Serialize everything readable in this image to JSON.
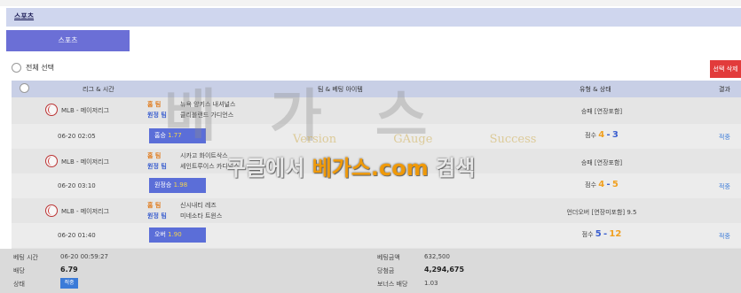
{
  "header": {
    "title": "스포츠"
  },
  "tabs": {
    "sport_tab": "스포츠"
  },
  "toolbar": {
    "select_all": "전체 선택",
    "delete_selected": "선택 삭제"
  },
  "table": {
    "headers": {
      "league_time": "리그 & 시간",
      "team_item": "팀 & 베팅 아이템",
      "type_status": "유형 & 상태",
      "result": "결과"
    }
  },
  "bets": [
    {
      "league": "MLB - 메이저리그",
      "home_tag": "홈 팀",
      "home_team": "뉴욕 양키스 내셔널스",
      "away_tag": "원정 팀",
      "away_team": "클리블랜드 가디언스",
      "bet_type": "승패 [연장포함]",
      "time": "06-20 02:05",
      "pick_label": "홈승",
      "pick_odds": "1.77",
      "score_label": "점수",
      "score_home": "4",
      "score_sep": "-",
      "score_away": "3",
      "result": "적중"
    },
    {
      "league": "MLB - 메이저리그",
      "home_tag": "홈 팀",
      "home_team": "시카고 화이트삭스",
      "away_tag": "원정 팀",
      "away_team": "세인트루이스 카디널스",
      "bet_type": "승패 [연장포함]",
      "time": "06-20 03:10",
      "pick_label": "원정승",
      "pick_odds": "1.98",
      "score_label": "점수",
      "score_home": "4",
      "score_sep": "-",
      "score_away": "5",
      "result": "적중"
    },
    {
      "league": "MLB - 메이저리그",
      "home_tag": "홈 팀",
      "home_team": "신시내티 레즈",
      "away_tag": "원정 팀",
      "away_team": "미네소타 트윈스",
      "bet_type": "언더오버 [연장미포함] 9.5",
      "time": "06-20 01:40",
      "pick_label": "오버",
      "pick_odds": "1.90",
      "score_label": "점수",
      "score_home": "5",
      "score_sep": "-",
      "score_away": "12",
      "result": "적중"
    }
  ],
  "summary": {
    "bet_time_label": "베팅 시간",
    "bet_time": "06-20 00:59:27",
    "odds_label": "배당",
    "odds": "6.79",
    "status_label": "상태",
    "status": "적중",
    "amount_label": "베팅금액",
    "amount": "632,500",
    "win_label": "당첨금",
    "win": "4,294,675",
    "bonus_label": "보너스 배당",
    "bonus": "1.03"
  },
  "watermark": {
    "brand": "베가스",
    "tagline": [
      "Version",
      "GAuge",
      "Success"
    ],
    "search_prefix": "구글에서 ",
    "search_highlight": "베가스.com",
    "search_suffix": " 검색"
  },
  "colors": {
    "accent": "#6b6fd6",
    "delete": "#e23b3b",
    "win": "#3b7bd8",
    "home": "#e07a1b",
    "away": "#3b5fcf"
  }
}
